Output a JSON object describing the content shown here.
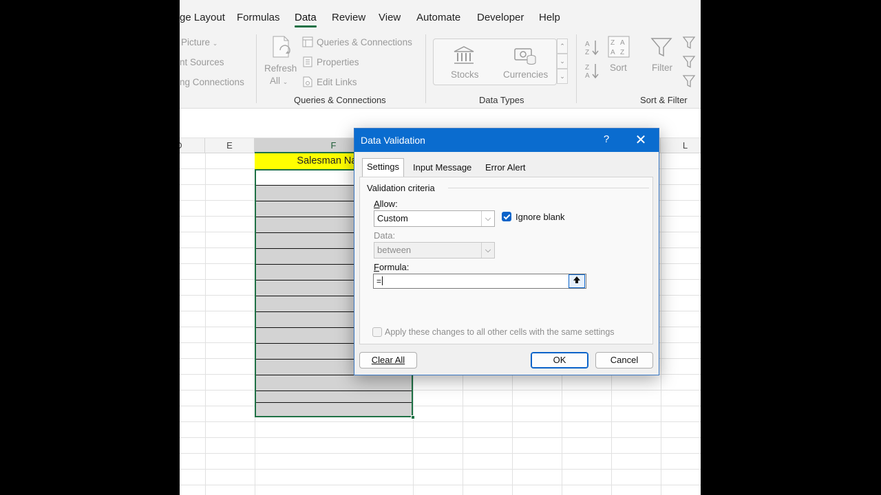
{
  "ribbon": {
    "tabs": [
      "ge Layout",
      "Formulas",
      "Data",
      "Review",
      "View",
      "Automate",
      "Developer",
      "Help"
    ],
    "active_tab": "Data",
    "get_data_items": [
      "Picture",
      "nt Sources",
      "ng Connections"
    ],
    "refresh_all": [
      "Refresh",
      "All"
    ],
    "queries_items": [
      "Queries & Connections",
      "Properties",
      "Edit Links"
    ],
    "queries_group_label": "Queries & Connections",
    "data_types": [
      "Stocks",
      "Currencies"
    ],
    "data_types_group_label": "Data Types",
    "sort_label": "Sort",
    "filter_label": "Filter",
    "sort_filter_group_label": "Sort & Filter"
  },
  "grid": {
    "columns": [
      "D",
      "E",
      "F",
      "L"
    ],
    "header_cell_text": "Salesman Name"
  },
  "dialog": {
    "title": "Data Validation",
    "help": "?",
    "close": "✕",
    "tabs": [
      "Settings",
      "Input Message",
      "Error Alert"
    ],
    "active_tab": "Settings",
    "section_title": "Validation criteria",
    "allow_label": "Allow:",
    "allow_value": "Custom",
    "ignore_blank_label": "Ignore blank",
    "ignore_blank_checked": true,
    "data_label": "Data:",
    "data_value": "between",
    "formula_label": "Formula:",
    "formula_value": "=",
    "apply_all_label": "Apply these changes to all other cells with the same settings",
    "apply_all_checked": false,
    "clear_all": "Clear All",
    "ok": "OK",
    "cancel": "Cancel"
  },
  "colors": {
    "accent": "#1e7145",
    "title_bar": "#0a6ccf",
    "highlight": "#ffff00"
  }
}
